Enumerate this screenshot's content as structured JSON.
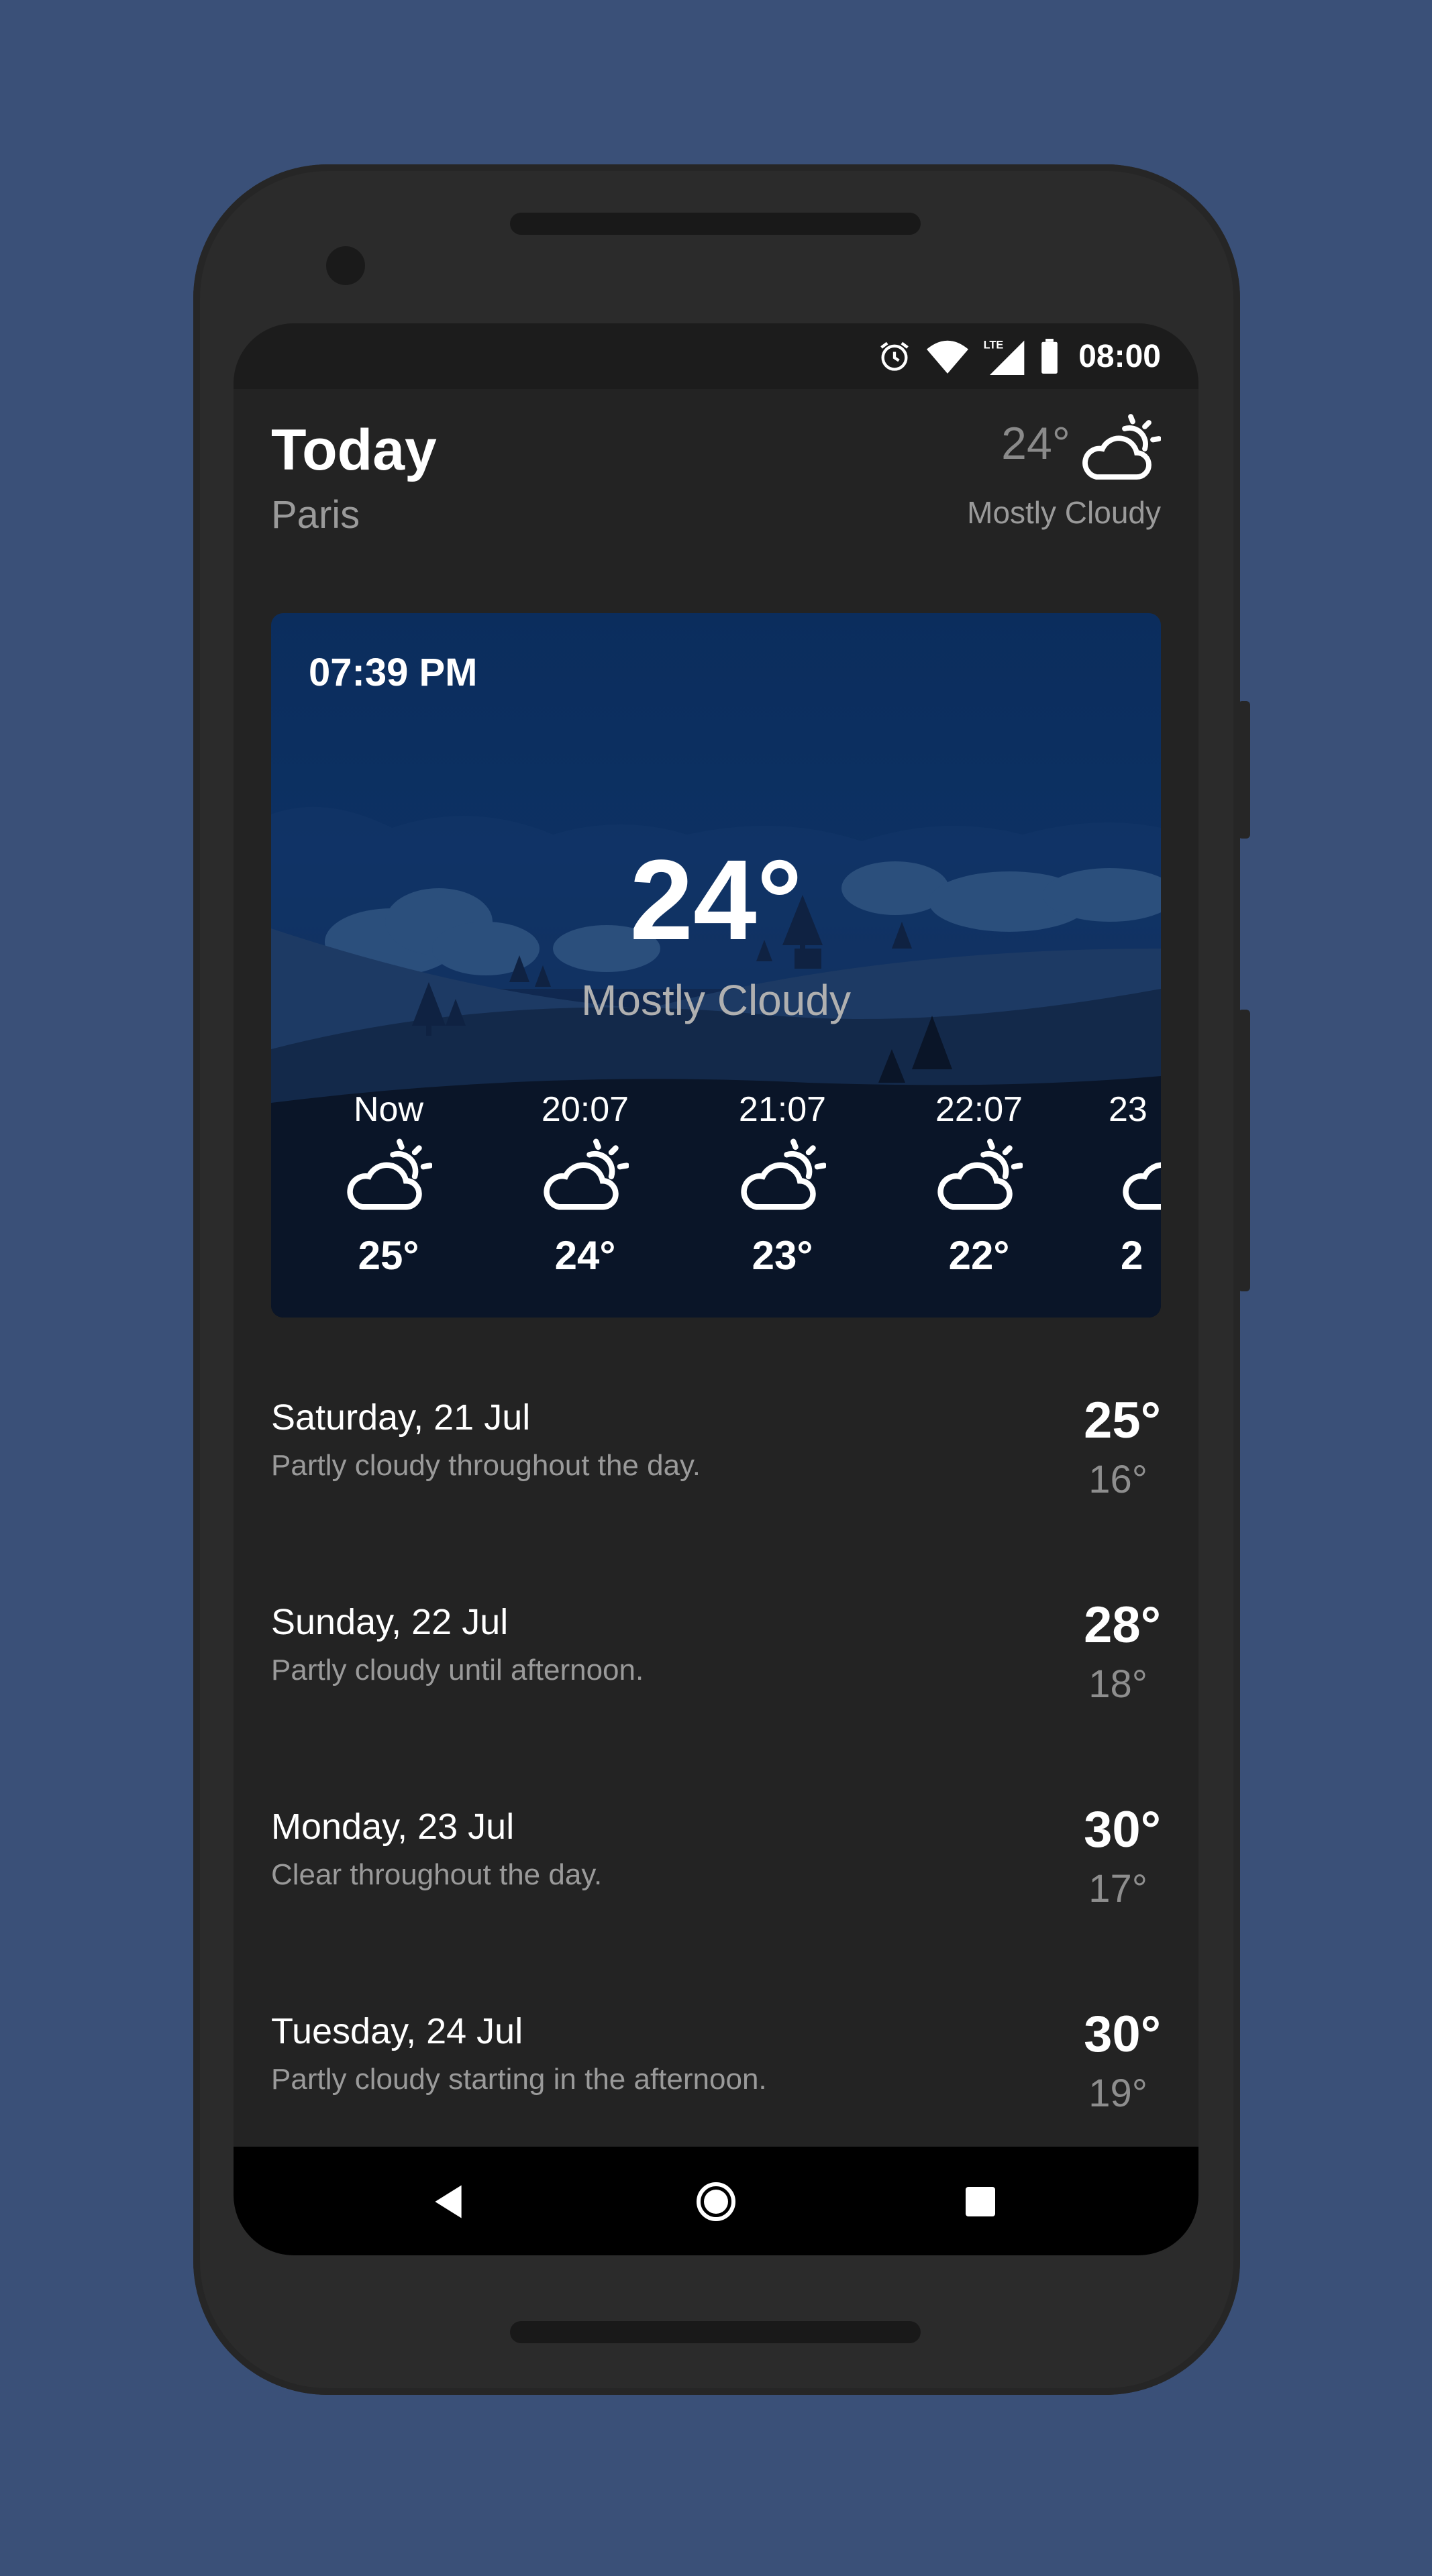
{
  "status_bar": {
    "time": "08:00",
    "icons": [
      "alarm-icon",
      "wifi-icon",
      "lte-signal-icon",
      "battery-icon"
    ],
    "lte_label": "LTE"
  },
  "header": {
    "title": "Today",
    "city": "Paris",
    "current_temp": "24°",
    "condition": "Mostly Cloudy",
    "icon": "partly-cloudy-icon"
  },
  "card": {
    "time": "07:39 PM",
    "temp": "24°",
    "condition": "Mostly Cloudy",
    "hourly": [
      {
        "time": "Now",
        "temp": "25°",
        "icon": "partly-cloudy-icon"
      },
      {
        "time": "20:07",
        "temp": "24°",
        "icon": "partly-cloudy-icon"
      },
      {
        "time": "21:07",
        "temp": "23°",
        "icon": "partly-cloudy-icon"
      },
      {
        "time": "22:07",
        "temp": "22°",
        "icon": "partly-cloudy-icon"
      },
      {
        "time": "23",
        "temp": "2",
        "icon": "partly-cloudy-icon"
      }
    ]
  },
  "days": [
    {
      "name": "Saturday, 21 Jul",
      "desc": "Partly cloudy throughout the day.",
      "high": "25°",
      "low": "16°"
    },
    {
      "name": "Sunday, 22 Jul",
      "desc": "Partly cloudy until afternoon.",
      "high": "28°",
      "low": "18°"
    },
    {
      "name": "Monday, 23 Jul",
      "desc": "Clear throughout the day.",
      "high": "30°",
      "low": "17°"
    },
    {
      "name": "Tuesday, 24 Jul",
      "desc": "Partly cloudy starting in the afternoon.",
      "high": "30°",
      "low": "19°"
    }
  ],
  "nav": {
    "icons": [
      "back-icon",
      "home-icon",
      "recents-icon"
    ]
  },
  "colors": {
    "background": "#3a5078",
    "screen": "#232323",
    "card_top": "#0b2d5d",
    "card_bottom": "#050c18"
  }
}
